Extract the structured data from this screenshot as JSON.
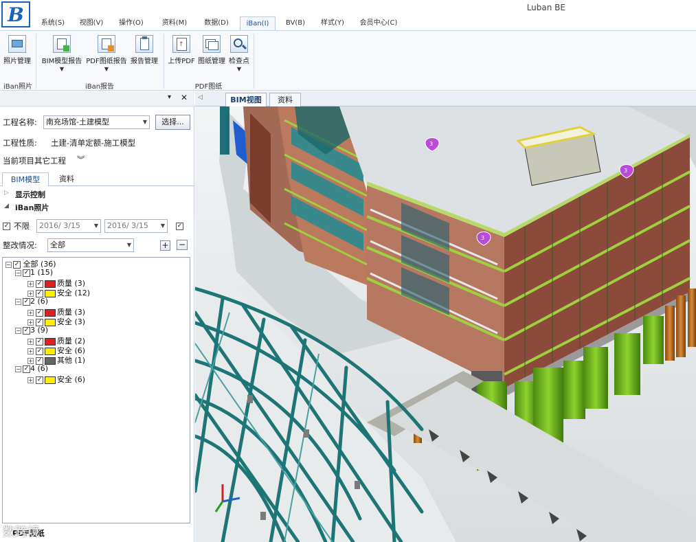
{
  "app": {
    "title": "Luban BE",
    "logo_letter": "B"
  },
  "menu": [
    "系统(S)",
    "视图(V)",
    "操作(O)",
    "资料(M)",
    "数据(D)",
    "iBan(I)",
    "BV(B)",
    "样式(Y)",
    "会员中心(C)"
  ],
  "ribbon": {
    "buttons": [
      "照片管理",
      "BIM模型报告",
      "PDF图纸报告",
      "报告管理",
      "上传PDF",
      "图纸管理",
      "检查点"
    ],
    "groups": [
      "iBan照片",
      "iBan报告",
      "PDF图纸"
    ]
  },
  "left": {
    "project_label": "工程名称:",
    "project_value": "南充场馆-土建模型",
    "select_button": "选择...",
    "nature_label": "工程性质:",
    "nature_value": "土建-清单定额-施工模型",
    "other_label": "当前项目其它工程",
    "other_chevron": "︾",
    "tabs": [
      "BIM模型",
      "资料"
    ],
    "sections": [
      "显示控制",
      "iBan照片"
    ],
    "unlimited": "不限",
    "date_from": "2016/ 3/15",
    "date_to": "2016/ 3/15",
    "status_label": "整改情况:",
    "status_value": "全部",
    "plus": "+",
    "minus": "−",
    "tree": {
      "root": "全部 (36)",
      "groups": [
        {
          "label": "1 (15)",
          "items": [
            {
              "label": "质量 (3)",
              "color": "#e02020"
            },
            {
              "label": "安全 (12)",
              "color": "#ffee00"
            }
          ]
        },
        {
          "label": "2 (6)",
          "items": [
            {
              "label": "质量 (3)",
              "color": "#e02020"
            },
            {
              "label": "安全 (3)",
              "color": "#ffee00"
            }
          ]
        },
        {
          "label": "3 (9)",
          "items": [
            {
              "label": "质量 (2)",
              "color": "#e02020"
            },
            {
              "label": "安全 (6)",
              "color": "#ffee00"
            },
            {
              "label": "其他 (1)",
              "color": "#666666"
            }
          ]
        },
        {
          "label": "4 (6)",
          "items": [
            {
              "label": "安全 (6)",
              "color": "#ffee00"
            }
          ]
        }
      ]
    },
    "bottom_label": "PDF图纸",
    "watermark": "数跨境"
  },
  "view": {
    "tabs": [
      "BIM视图",
      "资料"
    ],
    "markers": [
      "3",
      "3",
      "3"
    ]
  }
}
